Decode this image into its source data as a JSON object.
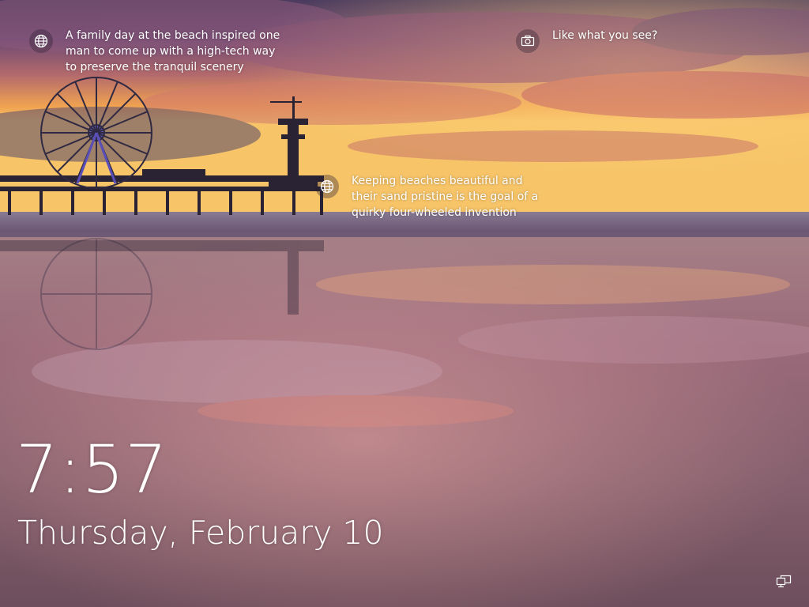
{
  "lockscreen": {
    "time": "7:57",
    "date": "Thursday, February 10"
  },
  "spotlight": {
    "items": [
      {
        "icon": "globe-icon",
        "text": "A family day at the beach inspired one man to come up with a high-tech way to preserve the tranquil scenery"
      },
      {
        "icon": "camera-icon",
        "text": "Like what you see?"
      },
      {
        "icon": "globe-icon",
        "text": "Keeping beaches beautiful and their sand pristine is the goal of a quirky four-wheeled invention"
      }
    ]
  },
  "system_tray": {
    "icon": "network-icon"
  },
  "colors": {
    "text": "#ffffff",
    "sky_top": "#5b4a6e",
    "sunset_orange": "#f3a04a",
    "sand": "#7c5a6a"
  }
}
